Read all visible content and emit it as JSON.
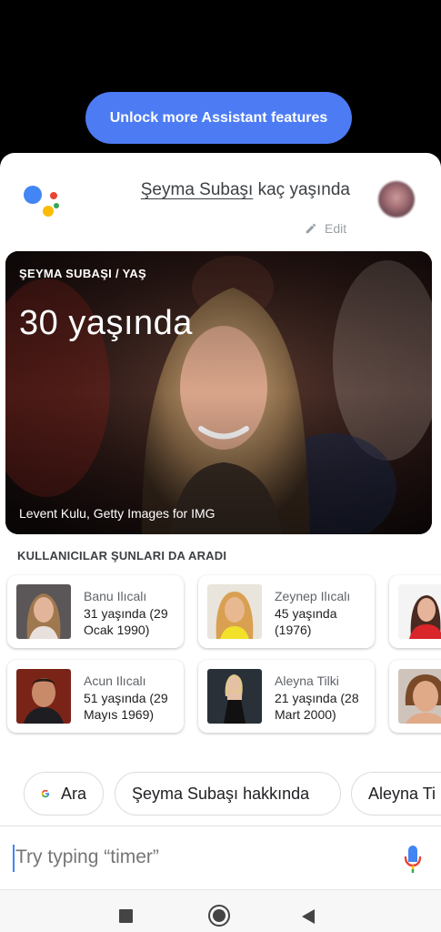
{
  "unlock_button": {
    "label": "Unlock more Assistant features"
  },
  "query": {
    "name": "Şeyma Subaşı",
    "rest": " kaç yaşında",
    "edit_label": "Edit"
  },
  "answer_card": {
    "label": "ŞEYMA SUBAŞI / YAŞ",
    "age": "30 yaşında",
    "credit": "Levent Kulu, Getty Images for IMG"
  },
  "related": {
    "title": "KULLANICILAR ŞUNLARI DA ARADI",
    "cards": [
      {
        "name": "Banu Ilıcalı",
        "detail": "31 yaşında (29 Ocak 1990)"
      },
      {
        "name": "Zeynep Ilıcalı",
        "detail": "45 yaşında (1976)"
      },
      {
        "name": "Acun Ilıcalı",
        "detail": "51 yaşında (29 Mayıs 1969)"
      },
      {
        "name": "Aleyna Tilki",
        "detail": "21 yaşında (28 Mart 2000)"
      }
    ]
  },
  "suggestion_chips": [
    {
      "label": "Ara",
      "icon": "google-g-icon"
    },
    {
      "label": "Şeyma Subaşı hakkında"
    },
    {
      "label": "Aleyna Ti"
    }
  ],
  "input": {
    "placeholder": "Try typing “timer”"
  },
  "colors": {
    "accent": "#4c7bf4",
    "google_blue": "#4285f4",
    "google_red": "#ea4335",
    "google_yellow": "#fbbc05",
    "google_green": "#34a853"
  }
}
